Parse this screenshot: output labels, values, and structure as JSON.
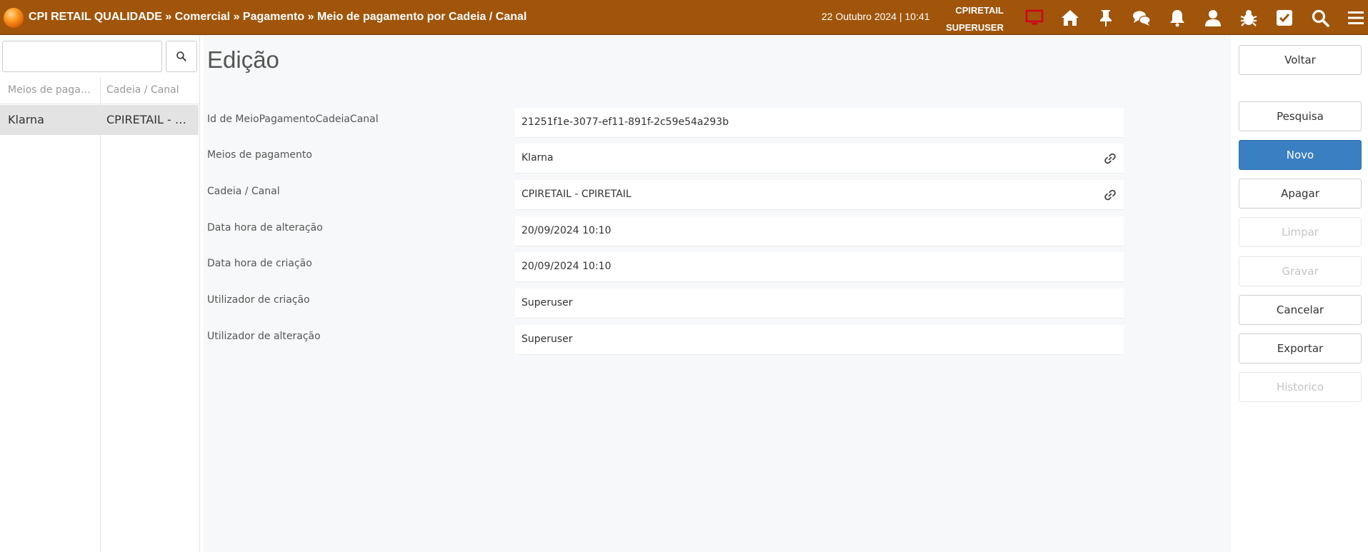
{
  "header": {
    "breadcrumb": "CPI RETAIL QUALIDADE » Comercial » Pagamento » Meio de pagamento por Cadeia / Canal",
    "datetime": "22 Outubro 2024 | 10:41",
    "company": "CPIRETAIL",
    "user": "SUPERUSER",
    "icons": [
      "monitor-icon",
      "home-icon",
      "pin-icon",
      "chat-icon",
      "bell-icon",
      "user-icon",
      "bug-icon",
      "checkbox-icon",
      "search-icon",
      "menu-icon"
    ],
    "monitor_icon_color": "#d0021b",
    "bar_color": "#a0550a"
  },
  "sidebar": {
    "search": {
      "value": "",
      "placeholder": ""
    },
    "columns": [
      "Meios de pagamento",
      "Cadeia / Canal"
    ],
    "rows": [
      {
        "meio": "Klarna",
        "cadeia": "CPIRETAIL - CPIRETAIL"
      }
    ]
  },
  "main": {
    "title": "Edição",
    "fields": [
      {
        "label": "Id de MeioPagamentoCadeiaCanal",
        "value": "21251f1e-3077-ef11-891f-2c59e54a293b"
      },
      {
        "label": "Meios de pagamento",
        "value": "Klarna",
        "link": true
      },
      {
        "label": "Cadeia / Canal",
        "value": "CPIRETAIL - CPIRETAIL",
        "link": true
      },
      {
        "label": "Data hora de alteração",
        "value": "20/09/2024 10:10"
      },
      {
        "label": "Data hora de criação",
        "value": "20/09/2024 10:10"
      },
      {
        "label": "Utilizador de criação",
        "value": "Superuser"
      },
      {
        "label": "Utilizador de alteração",
        "value": "Superuser"
      }
    ]
  },
  "actions": {
    "voltar": "Voltar",
    "pesquisa": "Pesquisa",
    "novo": "Novo",
    "apagar": "Apagar",
    "limpar": "Limpar",
    "gravar": "Gravar",
    "cancelar": "Cancelar",
    "exportar": "Exportar",
    "historico": "Historico",
    "primary_color": "#3a7fc2"
  }
}
